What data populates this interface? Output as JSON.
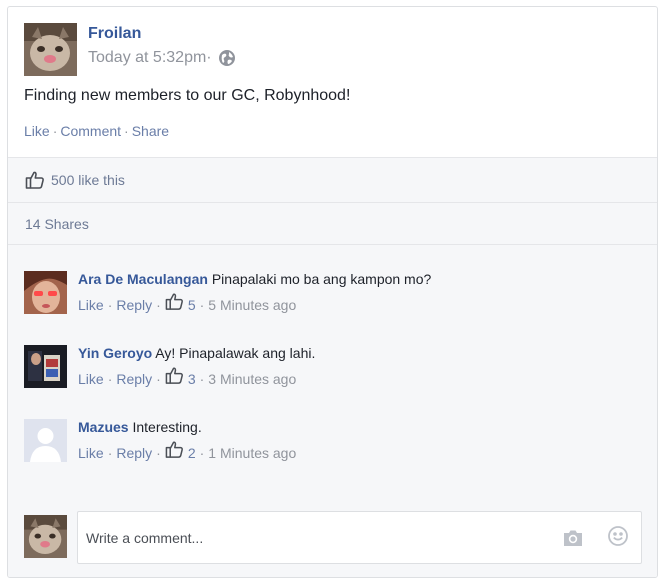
{
  "post": {
    "author": "Froilan",
    "timestamp": "Today at 5:32pm·",
    "privacy_icon": "globe-icon",
    "text": "Finding new members to our GC, Robynhood!",
    "actions": {
      "like": "Like",
      "comment": "Comment",
      "share": "Share",
      "separator": "·"
    }
  },
  "likes": {
    "icon": "thumbs-up-icon",
    "text": "500 like this"
  },
  "shares": {
    "text": "14 Shares"
  },
  "comments": [
    {
      "author": "Ara De Maculangan",
      "text": "Pinapalaki mo ba ang kampon mo?",
      "like_label": "Like",
      "reply_label": "Reply",
      "likes": "5",
      "ago": "5 Minutes ago"
    },
    {
      "author": "Yin Geroyo",
      "text": "Ay! Pinapalawak ang lahi.",
      "like_label": "Like",
      "reply_label": "Reply",
      "likes": "3",
      "ago": "3 Minutes ago"
    },
    {
      "author": "Mazues",
      "text": "Interesting.",
      "like_label": "Like",
      "reply_label": "Reply",
      "likes": "2",
      "ago": "1 Minutes ago"
    }
  ],
  "composer": {
    "placeholder": "Write a comment...",
    "camera_icon": "camera-icon",
    "emoji_icon": "smiley-icon"
  },
  "colors": {
    "link_blue": "#365899",
    "muted_link": "#6a7ea8",
    "grey_text": "#90949c",
    "panel_bg": "#f6f7f9",
    "border": "#dddfe2"
  }
}
